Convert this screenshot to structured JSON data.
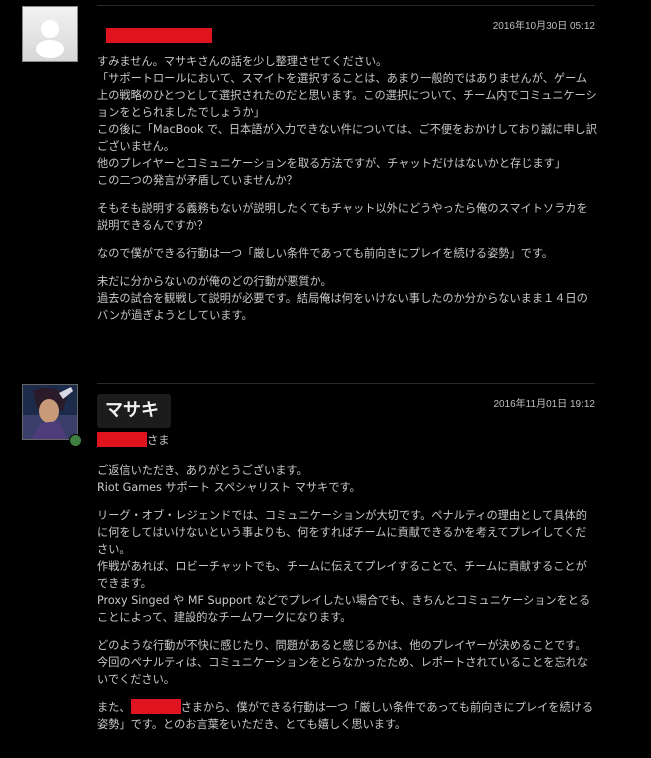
{
  "post1": {
    "timestamp": "2016年10月30日 05:12",
    "paragraphs": [
      "すみません。マサキさんの話を少し整理させてください。",
      "「サポートロールにおいて、スマイトを選択することは、あまり一般的ではありませんが、ゲーム上の戦略のひとつとして選択されたのだと思います。この選択について、チーム内でコミュニケーションをとられましたでしょうか」",
      "この後に「MacBook で、日本語が入力できない件については、ご不便をおかけしており誠に申し訳ございません。",
      "他のプレイヤーとコミュニケーションを取る方法ですが、チャットだけはないかと存じます」",
      "この二つの発言が矛盾していませんか？",
      "そもそも説明する義務もないが説明したくてもチャット以外にどうやったら俺のスマイトソラカを説明できるんですか？",
      "なので僕ができる行動は一つ「厳しい条件であっても前向きにプレイを続ける姿勢」です。",
      "未だに分からないのが俺のどの行動が悪質か。",
      "過去の試合を観戦して説明が必要です。結局俺は何をいけない事したのか分からないまま１４日のバンが過ぎようとしています。"
    ]
  },
  "post2": {
    "author": "マサキ",
    "timestamp": "2016年11月01日 19:12",
    "greeting_suffix": "さま",
    "paragraphs": [
      "ご返信いただき、ありがとうございます。",
      "Riot Games サポート スペシャリスト マサキです。",
      "リーグ・オブ・レジェンドでは、コミュニケーションが大切です。ペナルティの理由として具体的に何をしてはいけないという事よりも、何をすればチームに貢献できるかを考えてプレイしてください。",
      "作戦があれば、ロビーチャットでも、チームに伝えてプレイすることで、チームに貢献することができます。",
      "Proxy Singed や MF Support などでプレイしたい場合でも、きちんとコミュニケーションをとることによって、建設的なチームワークになります。",
      "どのような行動が不快に感じたり、問題があると感じるかは、他のプレイヤーが決めることです。",
      "今回のペナルティは、コミュニケーションをとらなかったため、レポートされていることを忘れないでください。",
      "さまから、僕ができる行動は一つ「厳しい条件であっても前向きにプレイを続ける姿勢」です。とのお言葉をいただき、とても嬉しく思います。"
    ],
    "prefix_label": "また、"
  }
}
